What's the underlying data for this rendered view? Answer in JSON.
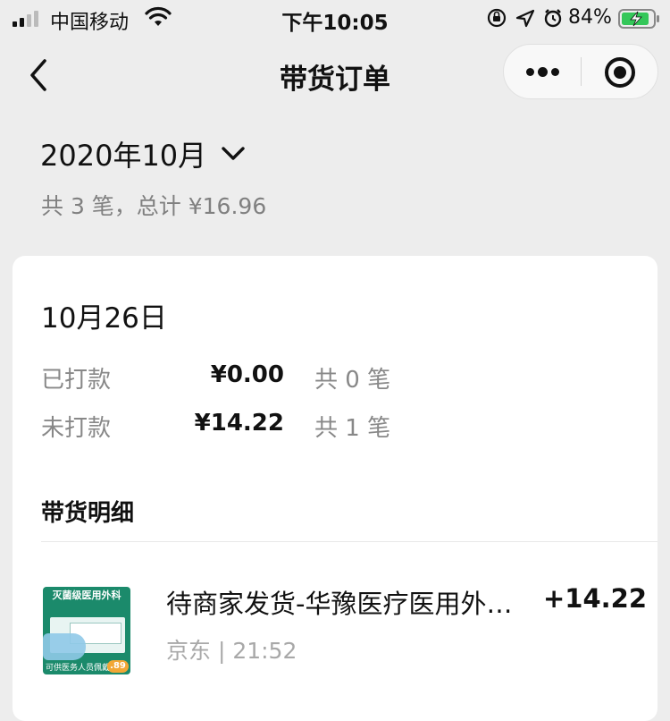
{
  "status_bar": {
    "carrier": "中国移动",
    "time": "下午10:05",
    "battery_percent": "84%"
  },
  "nav": {
    "title": "带货订单",
    "back_icon": "back-chevron-icon",
    "more_icon": "more-dots-icon",
    "close_icon": "miniprogram-close-icon"
  },
  "month": {
    "label": "2020年10月",
    "summary": "共 3 笔，总计 ¥16.96"
  },
  "day_card": {
    "date": "10月26日",
    "payments": [
      {
        "label": "已打款",
        "amount": "¥0.00",
        "count": "共 0 笔"
      },
      {
        "label": "未打款",
        "amount": "¥14.22",
        "count": "共 1 笔"
      }
    ],
    "detail_title": "带货明细",
    "orders": [
      {
        "title": "待商家发货-华豫医疗医用外…",
        "amount": "+14.22",
        "meta": "京东 | 21:52",
        "thumb": {
          "header": "灭菌级医用外科",
          "footer": "可供医务人员佩戴",
          "badge": ".89"
        }
      }
    ]
  },
  "colors": {
    "background": "#ededed",
    "card": "#ffffff",
    "muted_text": "#808080",
    "thumb_green": "#1b8a6b",
    "battery_green": "#34c759"
  }
}
